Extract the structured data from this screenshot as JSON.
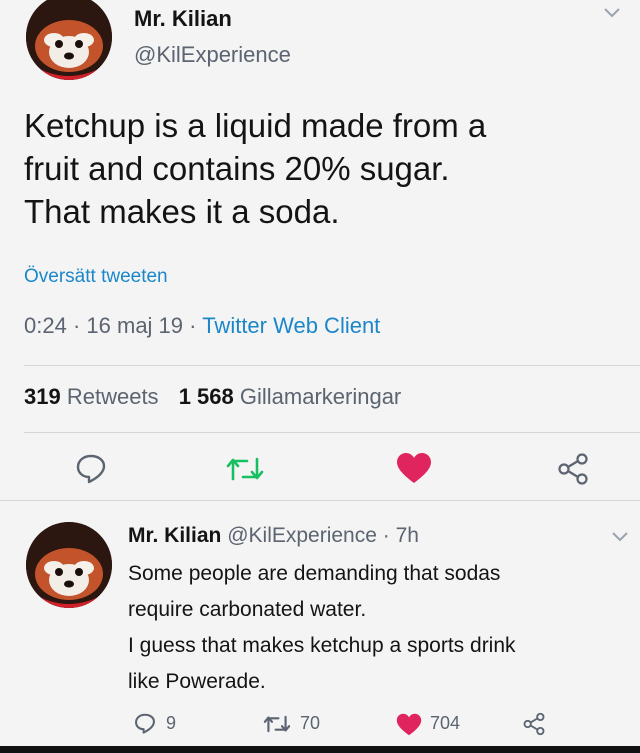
{
  "tweet": {
    "name": "Mr. Kilian",
    "handle": "@KilExperience",
    "text_lines": [
      "Ketchup is a liquid made from a",
      "fruit and contains 20% sugar.",
      "That makes it a soda."
    ],
    "translate": "Översätt tweeten",
    "time": "0:24",
    "sep1": "·",
    "date": "16 maj 19",
    "sep2": "·",
    "client": "Twitter Web Client",
    "retweets_count": "319",
    "retweets_label": "Retweets",
    "likes_count": "1 568",
    "likes_label": "Gillamarkeringar"
  },
  "reply": {
    "name": "Mr. Kilian",
    "handle": "@KilExperience",
    "sep": "·",
    "age": "7h",
    "text_lines": [
      "Some people are demanding that sodas",
      "require carbonated water.",
      "I guess that makes ketchup a sports drink",
      "like Powerade."
    ],
    "replies": "9",
    "retweets": "70",
    "likes": "704"
  },
  "colors": {
    "like_red": "#e0245e",
    "retweet_green": "#17bf63",
    "link_blue": "#1b87c9",
    "muted_gray": "#5b6470"
  },
  "icons": {
    "reply": "reply-icon",
    "retweet": "retweet-icon",
    "like": "heart-icon",
    "share": "share-icon",
    "caret": "chevron-down-icon"
  }
}
